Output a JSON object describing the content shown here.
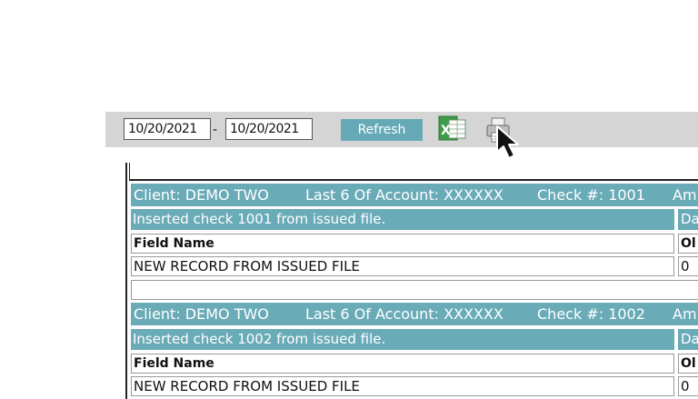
{
  "toolbar": {
    "start_date": "10/20/2021",
    "date_separator": "-",
    "end_date": "10/20/2021",
    "refresh_label": "Refresh",
    "excel_icon": "excel-export-icon",
    "print_icon": "printer-icon"
  },
  "colors": {
    "header_teal": "#6aabb8",
    "button_teal": "#66a9b6",
    "toolbar_gray": "#d5d5d5"
  },
  "records": [
    {
      "client": "Client: DEMO TWO",
      "account": "Last 6 Of Account: XXXXXX",
      "check": "Check #: 1001",
      "amount_partial": "Am",
      "message": "Inserted check 1001 from issued file.",
      "side_header": "Da",
      "field_header": "Field Name",
      "old_header": "Ol",
      "field_value": "NEW RECORD FROM ISSUED FILE",
      "old_value": "0"
    },
    {
      "client": "Client: DEMO TWO",
      "account": "Last 6 Of Account: XXXXXX",
      "check": "Check #: 1002",
      "amount_partial": "Am",
      "message": "Inserted check 1002 from issued file.",
      "side_header": "Da",
      "field_header": "Field Name",
      "old_header": "Ol",
      "field_value": "NEW RECORD FROM ISSUED FILE",
      "old_value": "0"
    }
  ]
}
